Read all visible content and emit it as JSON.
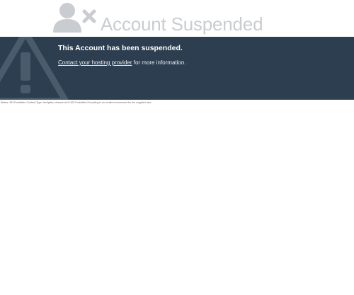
{
  "header": {
    "icon": "user-remove-icon",
    "title": "Account Suspended"
  },
  "banner": {
    "icon": "warning-triangle-icon",
    "heading": "This Account has been suspended.",
    "link_text": "Contact your hosting provider",
    "after_link_text": " for more information.",
    "background_color": "#2c3e50"
  },
  "status": {
    "text": "Status: 403 Forbidden Content-Type: text/plain; charset=utf-8 403 Forbidden Executing in an invalid environment for the supplied user."
  }
}
